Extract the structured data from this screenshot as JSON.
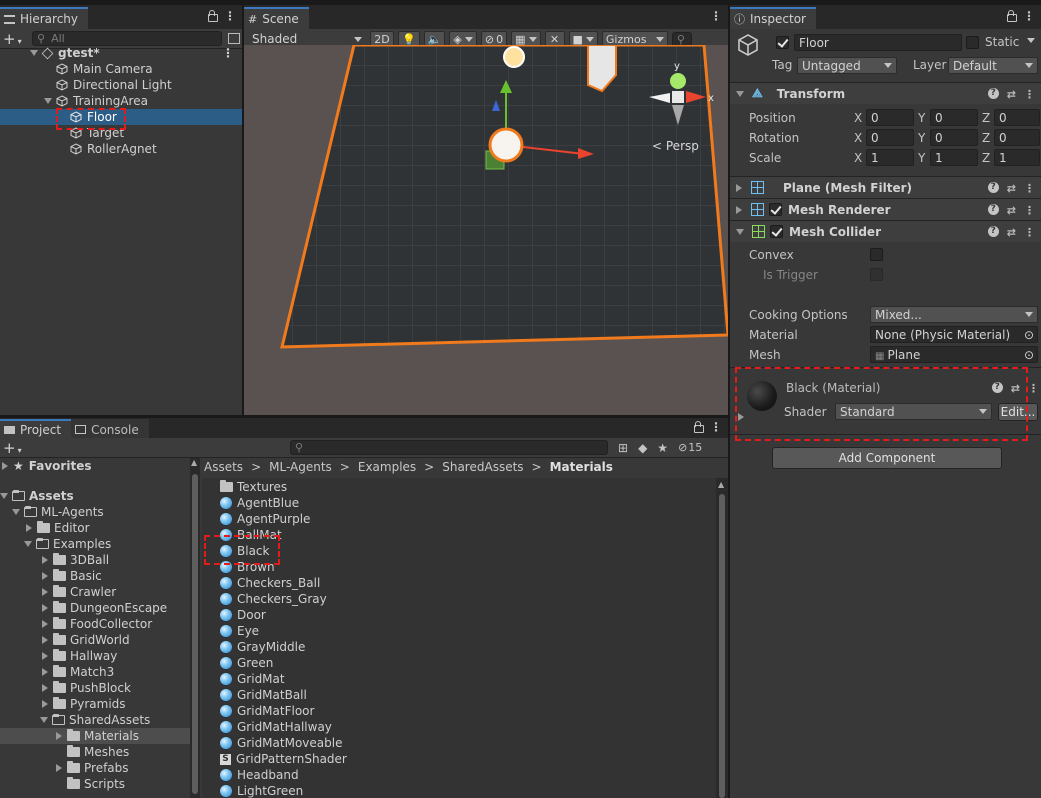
{
  "hierarchy": {
    "tab_label": "Hierarchy",
    "search_placeholder": "All",
    "scene_name": "gtest*",
    "items": [
      "Main Camera",
      "Directional Light",
      "TrainingArea",
      "Floor",
      "Target",
      "RollerAgnet"
    ]
  },
  "scene": {
    "tab_label": "Scene",
    "shading_mode": "Shaded",
    "btn_2d": "2D",
    "hidden_count": "0",
    "gizmos_label": "Gizmos",
    "persp_label": "Persp",
    "axis_x": "x",
    "axis_y": "y"
  },
  "inspector": {
    "tab_label": "Inspector",
    "object_name": "Floor",
    "static_label": "Static",
    "tag_label": "Tag",
    "tag_value": "Untagged",
    "layer_label": "Layer",
    "layer_value": "Default",
    "transform": {
      "title": "Transform",
      "position_label": "Position",
      "rotation_label": "Rotation",
      "scale_label": "Scale",
      "x": "X",
      "y": "Y",
      "z": "Z",
      "position": [
        "0",
        "0",
        "0"
      ],
      "rotation": [
        "0",
        "0",
        "0"
      ],
      "scale": [
        "1",
        "1",
        "1"
      ]
    },
    "mesh_filter_title": "Plane (Mesh Filter)",
    "mesh_renderer_title": "Mesh Renderer",
    "mesh_collider": {
      "title": "Mesh Collider",
      "convex_label": "Convex",
      "is_trigger_label": "Is Trigger",
      "cooking_label": "Cooking Options",
      "cooking_value": "Mixed...",
      "material_label": "Material",
      "material_value": "None (Physic Material)",
      "mesh_label": "Mesh",
      "mesh_value": "Plane"
    },
    "material": {
      "title": "Black (Material)",
      "shader_label": "Shader",
      "shader_value": "Standard",
      "edit_label": "Edit..."
    },
    "add_component_label": "Add Component"
  },
  "project": {
    "project_tab": "Project",
    "console_tab": "Console",
    "hidden_count": "15",
    "favorites": "Favorites",
    "assets": "Assets",
    "tree": [
      "ML-Agents",
      "Editor",
      "Examples",
      "3DBall",
      "Basic",
      "Crawler",
      "DungeonEscape",
      "FoodCollector",
      "GridWorld",
      "Hallway",
      "Match3",
      "PushBlock",
      "Pyramids",
      "SharedAssets",
      "Materials",
      "Meshes",
      "Prefabs",
      "Scripts"
    ],
    "breadcrumb": [
      "Assets",
      "ML-Agents",
      "Examples",
      "SharedAssets",
      "Materials"
    ],
    "files": [
      "Textures",
      "AgentBlue",
      "AgentPurple",
      "BallMat",
      "Black",
      "Brown",
      "Checkers_Ball",
      "Checkers_Gray",
      "Door",
      "Eye",
      "GrayMiddle",
      "Green",
      "GridMat",
      "GridMatBall",
      "GridMatFloor",
      "GridMatHallway",
      "GridMatMoveable",
      "GridPatternShader",
      "Headband",
      "LightGreen"
    ]
  },
  "colors": {
    "selection": "#2c5d87",
    "accent_tab": "#3a79bb",
    "highlight": "#e31b1b",
    "outline": "#f07a1c"
  }
}
